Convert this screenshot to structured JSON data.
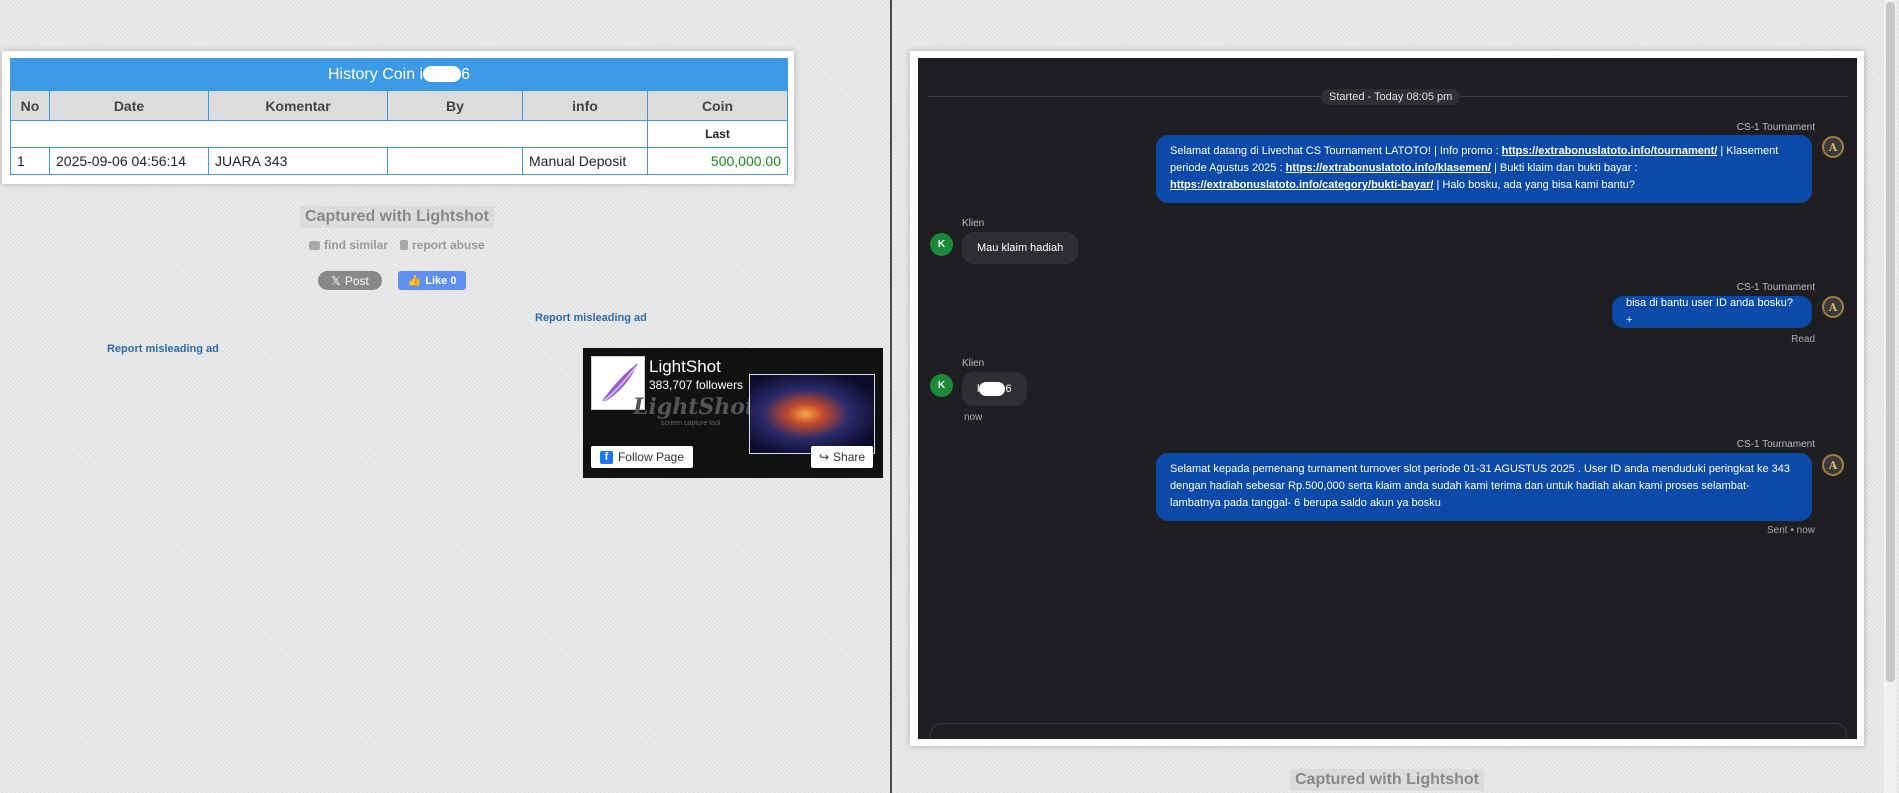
{
  "history": {
    "title_prefix": "History Coin i",
    "title_suffix": "6",
    "columns": [
      "No",
      "Date",
      "Komentar",
      "By",
      "info",
      "Coin"
    ],
    "last_label": "Last",
    "row": {
      "no": "1",
      "date": "2025-09-06 04:56:14",
      "komentar": "JUARA 343",
      "by": "",
      "info": "Manual Deposit",
      "coin": "500,000.00"
    }
  },
  "lightshot_left": {
    "captured": "Captured with Lightshot",
    "find_similar": "find similar",
    "report_abuse": "report abuse",
    "post": "Post",
    "like": "Like 0",
    "report_misleading_1": "Report misleading ad",
    "report_misleading_2": "Report misleading ad"
  },
  "fb_widget": {
    "name": "LightShot",
    "followers": "383,707 followers",
    "watermark": "LightShot",
    "watermark_sub": "screen capture tool",
    "follow": "Follow Page",
    "share": "Share"
  },
  "chat": {
    "started": "Started - Today 08:05 pm",
    "agent_name": "CS-1 Tournament",
    "client_name": "Klien",
    "client_initial": "K",
    "agent_initial": "A",
    "msg1": {
      "t1": "Selamat datang di Livechat CS Tournament LATOTO! | Info promo : ",
      "link1": "https://extrabonuslatoto.info/tournament/",
      "t2": " | Klasement periode Agustus 2025 : ",
      "link2": "https://extrabonuslatoto.info/klasemen/",
      "t3": " | Bukti klaim dan bukti bayar : ",
      "link3": "https://extrabonuslatoto.info/category/bukti-bayar/",
      "t4": " | Halo bosku, ada yang bisa kami bantu?"
    },
    "msg2": "Mau klaim hadiah",
    "msg3": "bisa di bantu user ID anda bosku?+",
    "msg3_status": "Read",
    "msg4_prefix": "l",
    "msg4_suffix": "6",
    "msg4_time": "now",
    "msg5": "Selamat kepada pemenang turnament turnover slot periode 01-31 AGUSTUS 2025 . User ID anda menduduki peringkat ke 343 dengan hadiah sebesar Rp.500,000 serta klaim anda sudah kami terima dan untuk hadiah akan kami proses selambat-lambatnya pada tanggal- 6 berupa saldo akun ya bosku",
    "msg5_status": "Sent • now"
  },
  "lightshot_right": {
    "captured": "Captured with Lightshot"
  }
}
